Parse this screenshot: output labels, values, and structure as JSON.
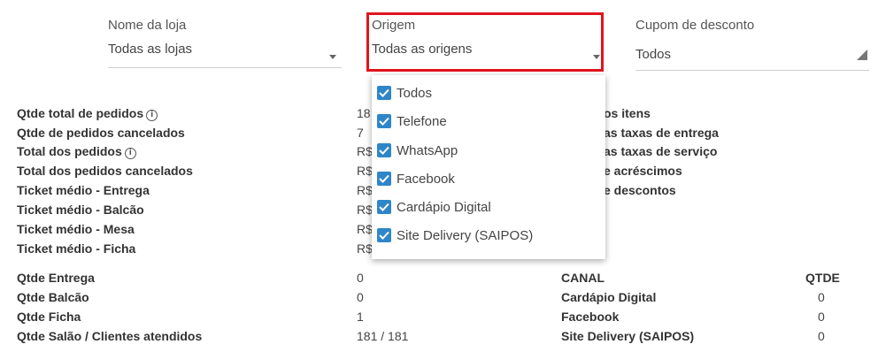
{
  "filters": {
    "store": {
      "label": "Nome da loja",
      "value": "Todas as lojas"
    },
    "origin": {
      "label": "Origem",
      "value": "Todas as origens"
    },
    "coupon": {
      "label": "Cupom de desconto",
      "value": "Todos"
    }
  },
  "origin_options": [
    {
      "label": "Todos",
      "checked": true
    },
    {
      "label": "Telefone",
      "checked": true
    },
    {
      "label": "WhatsApp",
      "checked": true
    },
    {
      "label": "Facebook",
      "checked": true
    },
    {
      "label": "Cardápio Digital",
      "checked": true
    },
    {
      "label": "Site Delivery (SAIPOS)",
      "checked": true
    }
  ],
  "stats_left": [
    {
      "label": "Qtde total de pedidos",
      "value": "18"
    },
    {
      "label": "Qtde de pedidos cancelados",
      "value": "7"
    },
    {
      "label": "Total dos pedidos",
      "value": "R$"
    },
    {
      "label": "Total dos pedidos cancelados",
      "value": "R$"
    },
    {
      "label": "Ticket médio - Entrega",
      "value": "R$"
    },
    {
      "label": "Ticket médio - Balcão",
      "value": "R$"
    },
    {
      "label": "Ticket médio - Mesa",
      "value": "R$"
    },
    {
      "label": "Ticket médio - Ficha",
      "value": "R$"
    }
  ],
  "stats_right_visible": [
    "os itens",
    "as taxas de entrega",
    "as taxas de serviço",
    "e acréscimos",
    "e descontos"
  ],
  "counts": [
    {
      "label": "Qtde Entrega",
      "value": "0"
    },
    {
      "label": "Qtde Balcão",
      "value": "0"
    },
    {
      "label": "Qtde Ficha",
      "value": "1"
    },
    {
      "label": "Qtde Salão / Clientes atendidos",
      "value": "181 / 181"
    }
  ],
  "channel_table": {
    "headers": {
      "canal": "CANAL",
      "qtde": "QTDE"
    },
    "rows": [
      {
        "canal": "Cardápio Digital",
        "qtde": "0"
      },
      {
        "canal": "Facebook",
        "qtde": "0"
      },
      {
        "canal": "Site Delivery (SAIPOS)",
        "qtde": "0"
      }
    ]
  },
  "colors": {
    "checkbox": "#2e86c9",
    "highlight": "#e0141e"
  },
  "icons": {
    "info": "info-icon",
    "check": "check-icon",
    "caret": "caret-down-icon"
  }
}
